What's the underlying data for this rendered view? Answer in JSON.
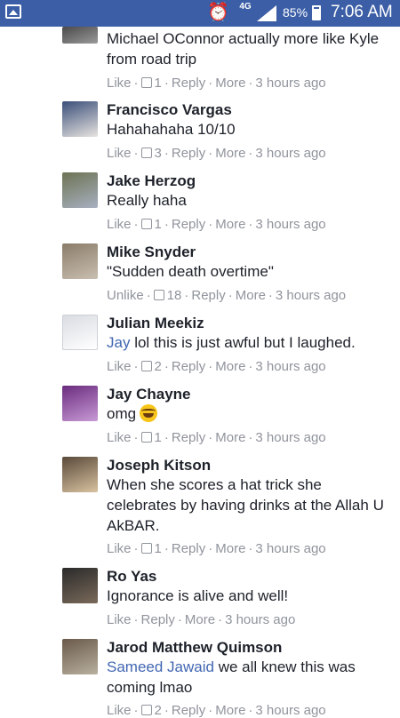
{
  "status_bar": {
    "network": "4G",
    "battery_percent": "85%",
    "battery_level": 0.85,
    "time": "7:06 AM"
  },
  "comments": [
    {
      "name": "",
      "text_prefix": "",
      "mention": "",
      "text": "Michael OConnor actually more like Kyle from road trip",
      "like_label": "Like",
      "likes": "1",
      "reply_label": "Reply",
      "more_label": "More",
      "time": "3 hours ago",
      "avatar_colors": [
        "#4a4a4a",
        "#9a9a9a"
      ]
    },
    {
      "name": "Francisco Vargas",
      "text": "Hahahahaha 10/10",
      "like_label": "Like",
      "likes": "3",
      "reply_label": "Reply",
      "more_label": "More",
      "time": "3 hours ago",
      "avatar_colors": [
        "#3a4f7a",
        "#e8e4e0"
      ]
    },
    {
      "name": "Jake Herzog",
      "text": "Really haha",
      "like_label": "Like",
      "likes": "1",
      "reply_label": "Reply",
      "more_label": "More",
      "time": "3 hours ago",
      "avatar_colors": [
        "#6d7354",
        "#a7b0c0"
      ]
    },
    {
      "name": "Mike Snyder",
      "text": "\"Sudden death overtime\"",
      "like_label": "Unlike",
      "likes": "18",
      "reply_label": "Reply",
      "more_label": "More",
      "time": "3 hours ago",
      "avatar_colors": [
        "#8a7c6a",
        "#c9bfb0"
      ]
    },
    {
      "name": "Julian Meekiz",
      "mention": "Jay",
      "text": " lol this is just awful but I laughed.",
      "like_label": "Like",
      "likes": "2",
      "reply_label": "Reply",
      "more_label": "More",
      "time": "3 hours ago",
      "avatar_colors": [
        "#d9dce2",
        "#ffffff"
      ]
    },
    {
      "name": "Jay Chayne",
      "text": "omg",
      "emoji": "laughing-tears-emoji",
      "like_label": "Like",
      "likes": "1",
      "reply_label": "Reply",
      "more_label": "More",
      "time": "3 hours ago",
      "avatar_colors": [
        "#6a2c7e",
        "#c89ad6"
      ]
    },
    {
      "name": "Joseph Kitson",
      "text": "When she scores a hat trick she celebrates by having drinks at the Allah U AkBAR.",
      "like_label": "Like",
      "likes": "1",
      "reply_label": "Reply",
      "more_label": "More",
      "time": "3 hours ago",
      "avatar_colors": [
        "#5a4a3a",
        "#d8c2a0"
      ]
    },
    {
      "name": "Ro Yas",
      "text": "Ignorance is alive and well!",
      "like_label": "Like",
      "reply_label": "Reply",
      "more_label": "More",
      "time": "3 hours ago",
      "avatar_colors": [
        "#2a2a2a",
        "#7a6a5a"
      ]
    },
    {
      "name": "Jarod Matthew Quimson",
      "mention": "Sameed Jawaid",
      "text": " we all knew this was coming lmao",
      "like_label": "Like",
      "likes": "2",
      "reply_label": "Reply",
      "more_label": "More",
      "time": "3 hours ago",
      "avatar_colors": [
        "#6a5a4a",
        "#b8b0a0"
      ]
    }
  ]
}
